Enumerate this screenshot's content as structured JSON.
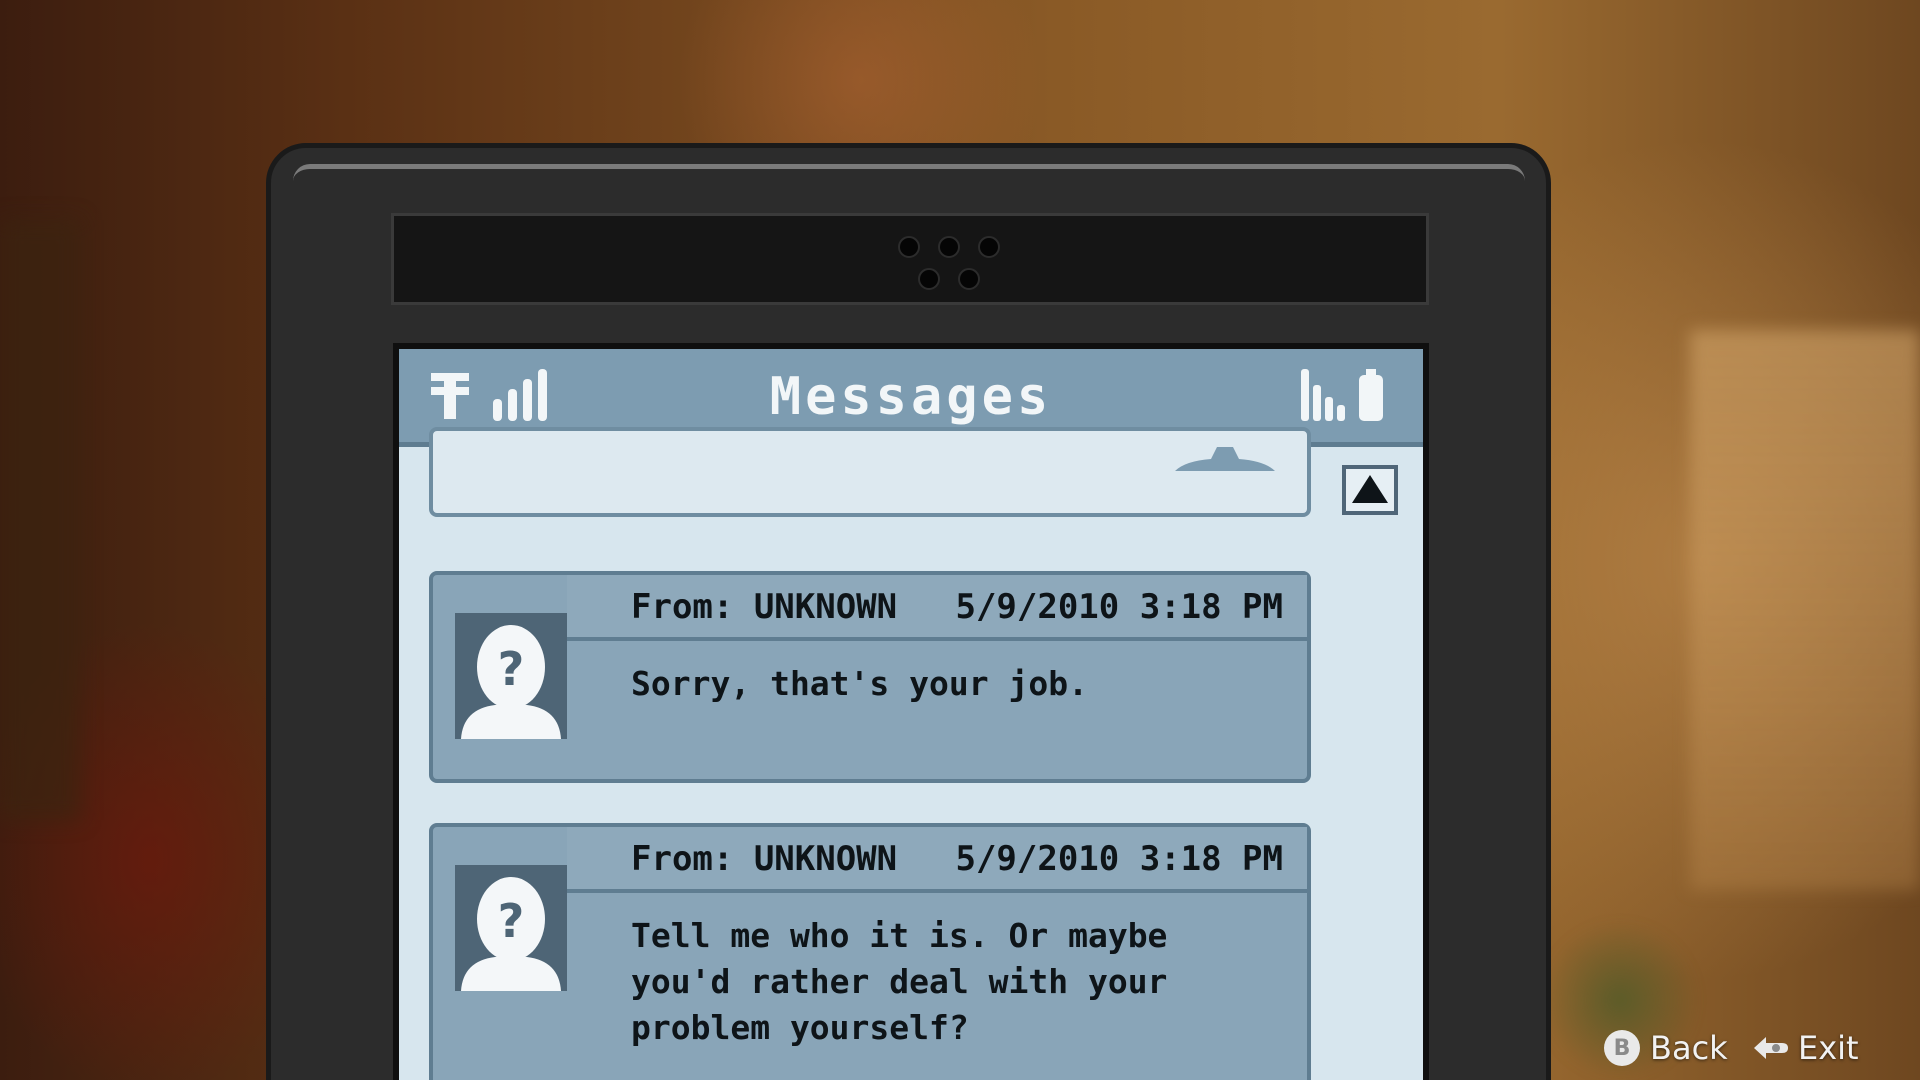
{
  "phone": {
    "title": "Messages",
    "status_icons": [
      "network-operator-icon",
      "signal-strength-icon",
      "audio-levels-icon",
      "battery-icon"
    ]
  },
  "messages": [
    {
      "from": "From: UNKNOWN",
      "timestamp": "5/9/2010 3:18 PM",
      "body": "Sorry, that's your job.",
      "avatar": "unknown-contact-icon"
    },
    {
      "from": "From: UNKNOWN",
      "timestamp": "5/9/2010 3:18 PM",
      "body": "Tell me who it is. Or maybe you'd rather deal with your problem yourself?",
      "avatar": "unknown-contact-icon"
    }
  ],
  "controls": {
    "back": {
      "button": "B",
      "label": "Back"
    },
    "exit": {
      "label": "Exit",
      "icon": "back-arrow-button-icon"
    }
  },
  "colors": {
    "header": "#7d9cb1",
    "screen": "#d7e6ee",
    "card": "#89a5b8",
    "avatar": "#4e6576",
    "phone_body": "#2c2c2c"
  }
}
